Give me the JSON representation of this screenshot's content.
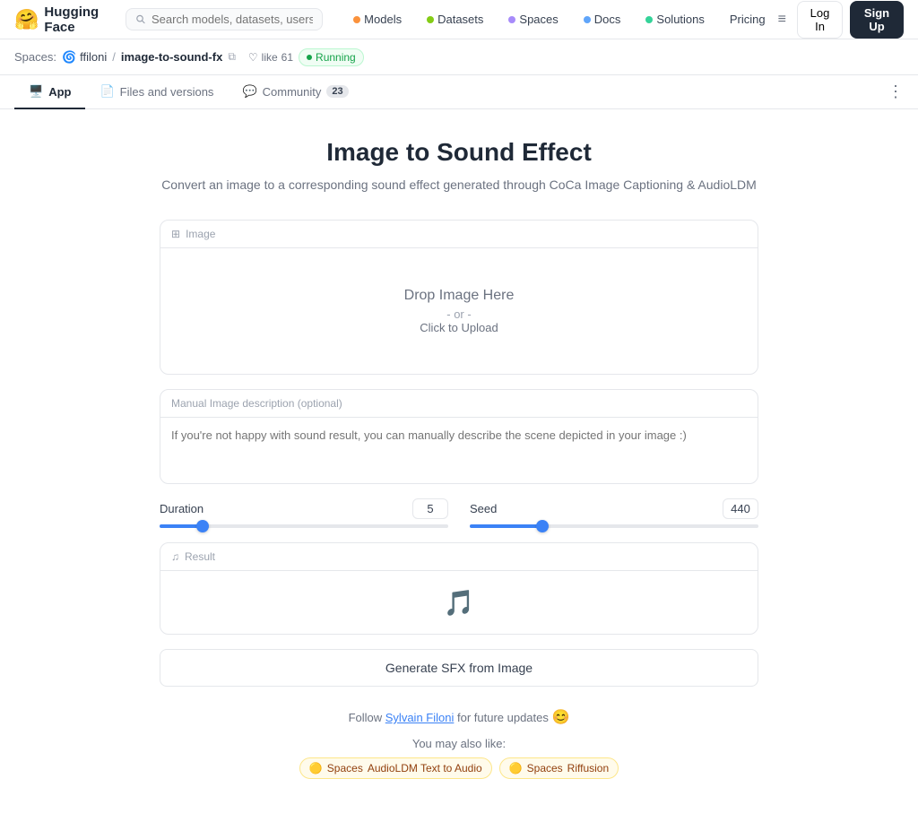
{
  "brand": {
    "name": "Hugging Face",
    "emoji": "🤗"
  },
  "nav": {
    "search_placeholder": "Search models, datasets, users...",
    "items": [
      {
        "id": "models",
        "label": "Models",
        "dot_color": "#fb923c"
      },
      {
        "id": "datasets",
        "label": "Datasets",
        "dot_color": "#84cc16"
      },
      {
        "id": "spaces",
        "label": "Spaces",
        "dot_color": "#a78bfa"
      },
      {
        "id": "docs",
        "label": "Docs",
        "dot_color": "#60a5fa"
      },
      {
        "id": "solutions",
        "label": "Solutions",
        "dot_color": "#34d399"
      },
      {
        "id": "pricing",
        "label": "Pricing",
        "dot_color": null
      }
    ],
    "login_label": "Log In",
    "signup_label": "Sign Up"
  },
  "spaces_bar": {
    "spaces_label": "Spaces:",
    "author": "ffiloni",
    "separator": "/",
    "space_name": "image-to-sound-fx",
    "like_label": "like",
    "like_count": "61",
    "status_label": "Running"
  },
  "tabs": [
    {
      "id": "app",
      "label": "App",
      "icon": "🖥️",
      "active": true,
      "badge": null
    },
    {
      "id": "files",
      "label": "Files and versions",
      "icon": "📄",
      "active": false,
      "badge": null
    },
    {
      "id": "community",
      "label": "Community",
      "icon": "💬",
      "active": false,
      "badge": "23"
    }
  ],
  "app": {
    "title": "Image to Sound Effect",
    "description": "Convert an image to a corresponding sound effect generated through\nCoCa Image Captioning & AudioLDM",
    "image_panel_label": "Image",
    "drop_text": "Drop Image Here",
    "drop_or": "- or -",
    "drop_click": "Click to Upload",
    "manual_desc_label": "Manual Image description (optional)",
    "manual_desc_placeholder": "If you're not happy with sound result, you can manually describe the scene depicted in your image :)",
    "duration_label": "Duration",
    "duration_value": "5",
    "duration_percent": 15,
    "seed_label": "Seed",
    "seed_value": "440",
    "seed_percent": 25,
    "result_label": "Result",
    "generate_btn_label": "Generate SFX from Image",
    "follow_text": "Follow ",
    "follow_name": "Sylvain Filoni",
    "follow_suffix": " for future updates",
    "follow_emoji": "😊",
    "also_like_label": "You may also like:",
    "tags": [
      {
        "id": "spaces-audioldm",
        "prefix_label": "Spaces",
        "name_label": "AudioLDM Text to Audio",
        "style": "spaces-blue"
      },
      {
        "id": "spaces-riffusion",
        "prefix_label": "Spaces",
        "name_label": "Riffusion",
        "style": "spaces-blue"
      }
    ]
  }
}
